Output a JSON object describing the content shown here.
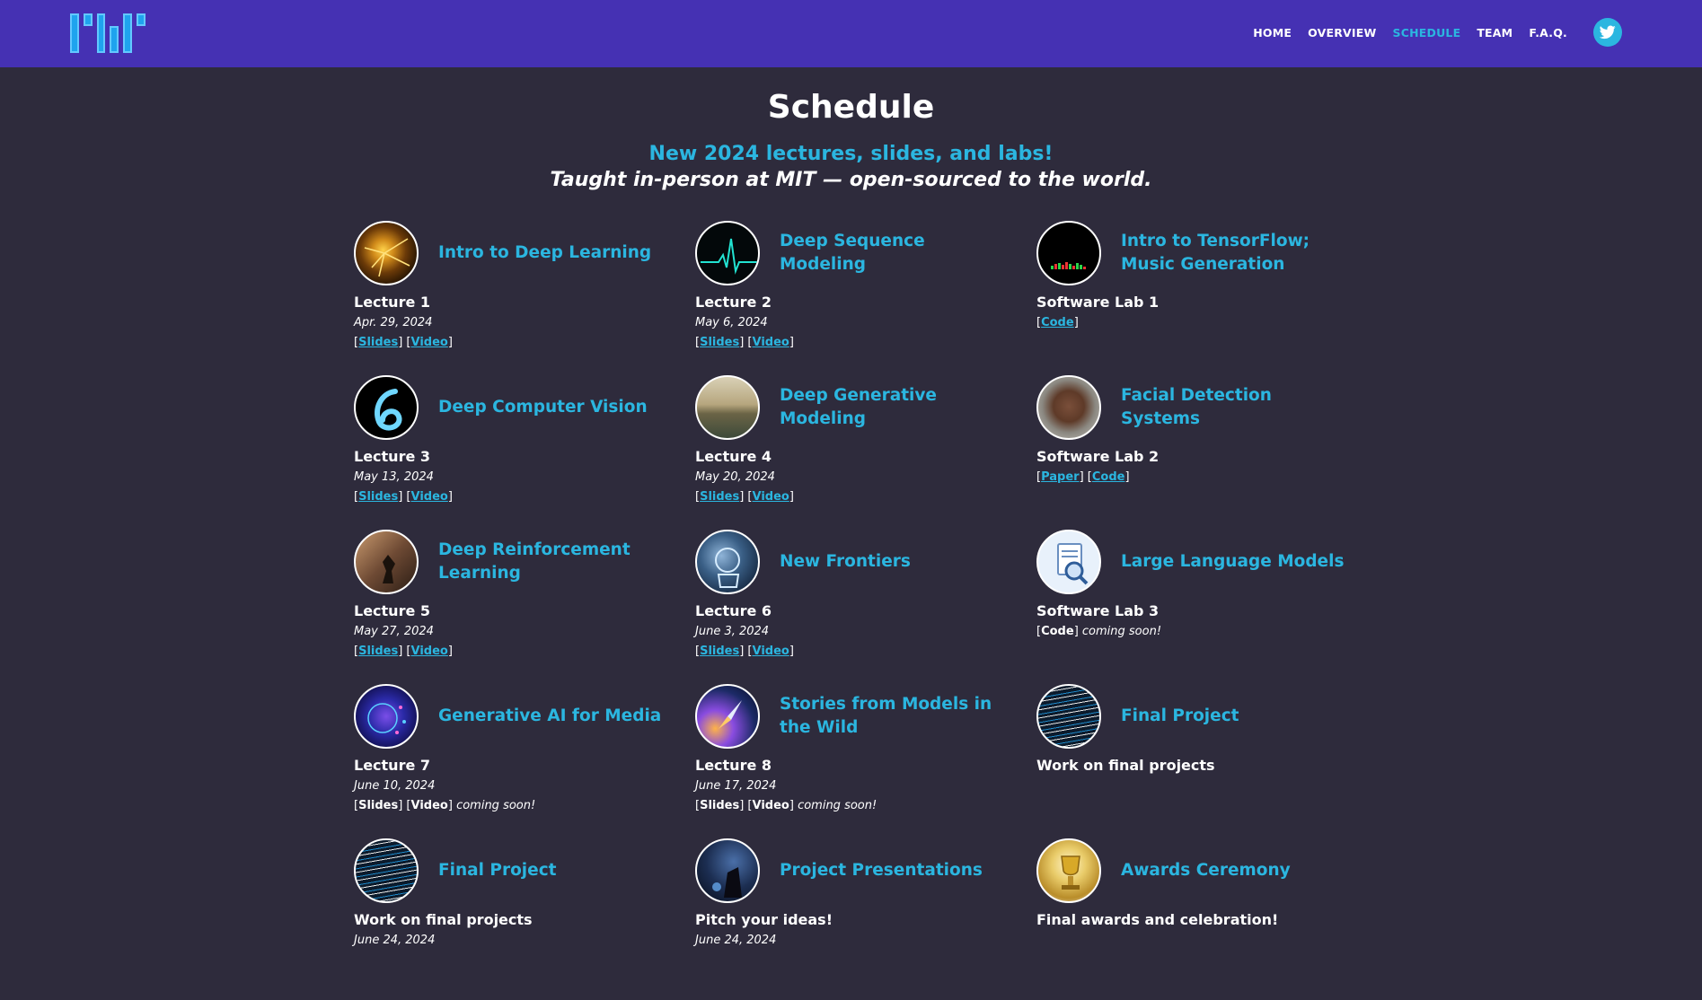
{
  "nav": {
    "items": [
      "HOME",
      "OVERVIEW",
      "SCHEDULE",
      "TEAM",
      "F.A.Q."
    ],
    "active": "SCHEDULE"
  },
  "page": {
    "title": "Schedule",
    "subtitle_line1": "New 2024 lectures, slides, and labs!",
    "subtitle_line2": "Taught in-person at MIT — open-sourced to the world."
  },
  "items": [
    {
      "title": "Intro to Deep Learning",
      "label": "Lecture 1",
      "date": "Apr. 29, 2024",
      "links": [
        {
          "text": "Slides",
          "active": true
        },
        {
          "text": "Video",
          "active": true
        }
      ],
      "note": ""
    },
    {
      "title": "Deep Sequence Modeling",
      "label": "Lecture 2",
      "date": "May 6, 2024",
      "links": [
        {
          "text": "Slides",
          "active": true
        },
        {
          "text": "Video",
          "active": true
        }
      ],
      "note": ""
    },
    {
      "title": "Intro to TensorFlow; Music Generation",
      "label": "Software Lab 1",
      "date": "",
      "links": [
        {
          "text": "Code",
          "active": true
        }
      ],
      "note": ""
    },
    {
      "title": "Deep Computer Vision",
      "label": "Lecture 3",
      "date": "May 13, 2024",
      "links": [
        {
          "text": "Slides",
          "active": true
        },
        {
          "text": "Video",
          "active": true
        }
      ],
      "note": ""
    },
    {
      "title": "Deep Generative Modeling",
      "label": "Lecture 4",
      "date": "May 20, 2024",
      "links": [
        {
          "text": "Slides",
          "active": true
        },
        {
          "text": "Video",
          "active": true
        }
      ],
      "note": ""
    },
    {
      "title": "Facial Detection Systems",
      "label": "Software Lab 2",
      "date": "",
      "links": [
        {
          "text": "Paper",
          "active": true
        },
        {
          "text": "Code",
          "active": true
        }
      ],
      "note": ""
    },
    {
      "title": "Deep Reinforcement Learning",
      "label": "Lecture 5",
      "date": "May 27, 2024",
      "links": [
        {
          "text": "Slides",
          "active": true
        },
        {
          "text": "Video",
          "active": true
        }
      ],
      "note": ""
    },
    {
      "title": "New Frontiers",
      "label": "Lecture 6",
      "date": "June 3, 2024",
      "links": [
        {
          "text": "Slides",
          "active": true
        },
        {
          "text": "Video",
          "active": true
        }
      ],
      "note": ""
    },
    {
      "title": "Large Language Models",
      "label": "Software Lab 3",
      "date": "",
      "links": [
        {
          "text": "Code",
          "active": false
        }
      ],
      "note": "coming soon!"
    },
    {
      "title": "Generative AI for Media",
      "label": "Lecture 7",
      "date": "June 10, 2024",
      "links": [
        {
          "text": "Slides",
          "active": false
        },
        {
          "text": "Video",
          "active": false
        }
      ],
      "note": "coming soon!"
    },
    {
      "title": "Stories from Models in the Wild",
      "label": "Lecture 8",
      "date": "June 17, 2024",
      "links": [
        {
          "text": "Slides",
          "active": false
        },
        {
          "text": "Video",
          "active": false
        }
      ],
      "note": "coming soon!"
    },
    {
      "title": "Final Project",
      "label": "Work on final projects",
      "date": "",
      "links": [],
      "note": ""
    },
    {
      "title": "Final Project",
      "label": "Work on final projects",
      "date": "June 24, 2024",
      "links": [],
      "note": ""
    },
    {
      "title": "Project Presentations",
      "label": "Pitch your ideas!",
      "date": "June 24, 2024",
      "links": [],
      "note": ""
    },
    {
      "title": "Awards Ceremony",
      "label": "Final awards and celebration!",
      "date": "",
      "links": [],
      "note": ""
    }
  ],
  "colors": {
    "header": "#4531b3",
    "background": "#2e2b3c",
    "accent": "#2bb6e0"
  },
  "icons": {
    "social": "twitter-icon"
  }
}
